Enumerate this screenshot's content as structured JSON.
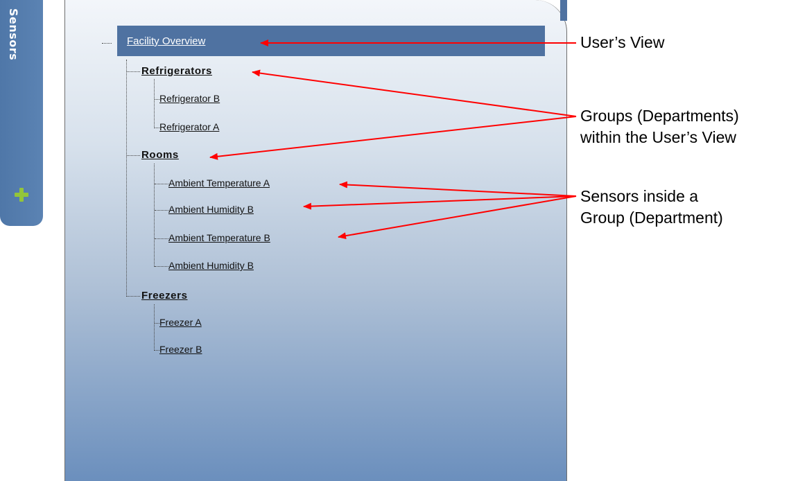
{
  "sidebar": {
    "tab_label": "Sensors",
    "add_icon": "plus-icon"
  },
  "tree": {
    "root": "Facility Overview",
    "groups": [
      {
        "label": "Refrigerators",
        "sensors": [
          "Refrigerator B",
          "Refrigerator A"
        ]
      },
      {
        "label": "Rooms",
        "sensors": [
          "Ambient Temperature A",
          "Ambient Humidity B",
          "Ambient Temperature B",
          "Ambient Humidity B"
        ]
      },
      {
        "label": "Freezers",
        "sensors": [
          "Freezer A",
          "Freezer B"
        ]
      }
    ]
  },
  "annotations": {
    "users_view": "User’s View",
    "groups_line1": "Groups (Departments)",
    "groups_line2": "within the User’s View",
    "sensors_line1": "Sensors inside a",
    "sensors_line2": "Group (Department)"
  },
  "colors": {
    "accent": "#4f72a1",
    "arrow": "#ff0000",
    "plus": "#93c53a"
  }
}
